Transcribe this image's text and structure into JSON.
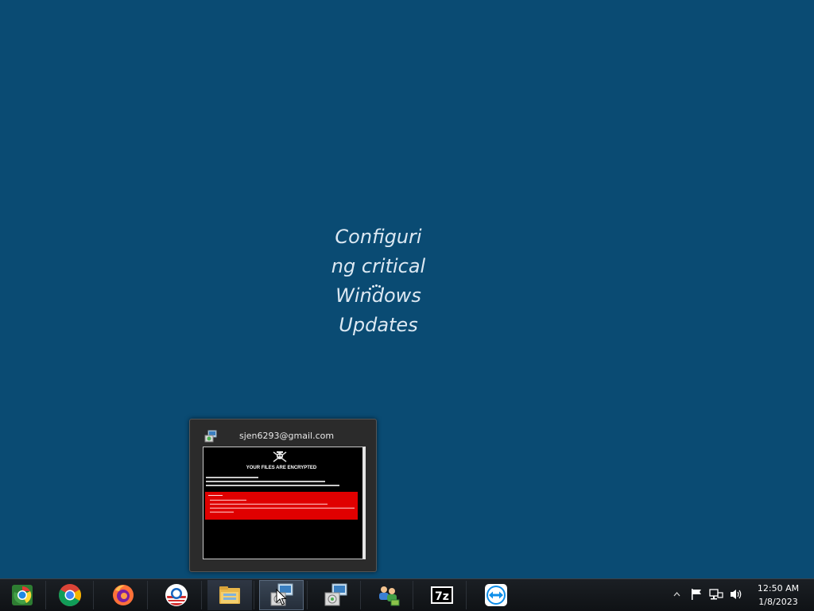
{
  "desktop": {
    "status_text": "Configuring critical Windows Updates",
    "background_color": "#0a4b73"
  },
  "preview": {
    "title": "sjen6293@gmail.com",
    "ransom_heading": "YOUR FILES ARE ENCRYPTED"
  },
  "taskbar": {
    "items": [
      {
        "name": "chromium-icon"
      },
      {
        "name": "chrome-icon"
      },
      {
        "name": "firefox-icon"
      },
      {
        "name": "obama-logo-icon"
      },
      {
        "name": "file-explorer-icon"
      },
      {
        "name": "installer-icon",
        "active": true
      },
      {
        "name": "installer-icon-2"
      },
      {
        "name": "network-users-icon"
      },
      {
        "name": "7zip-icon",
        "label": "7z"
      },
      {
        "name": "teamviewer-icon"
      }
    ]
  },
  "tray": {
    "time": "12:50 AM",
    "date": "1/8/2023"
  }
}
